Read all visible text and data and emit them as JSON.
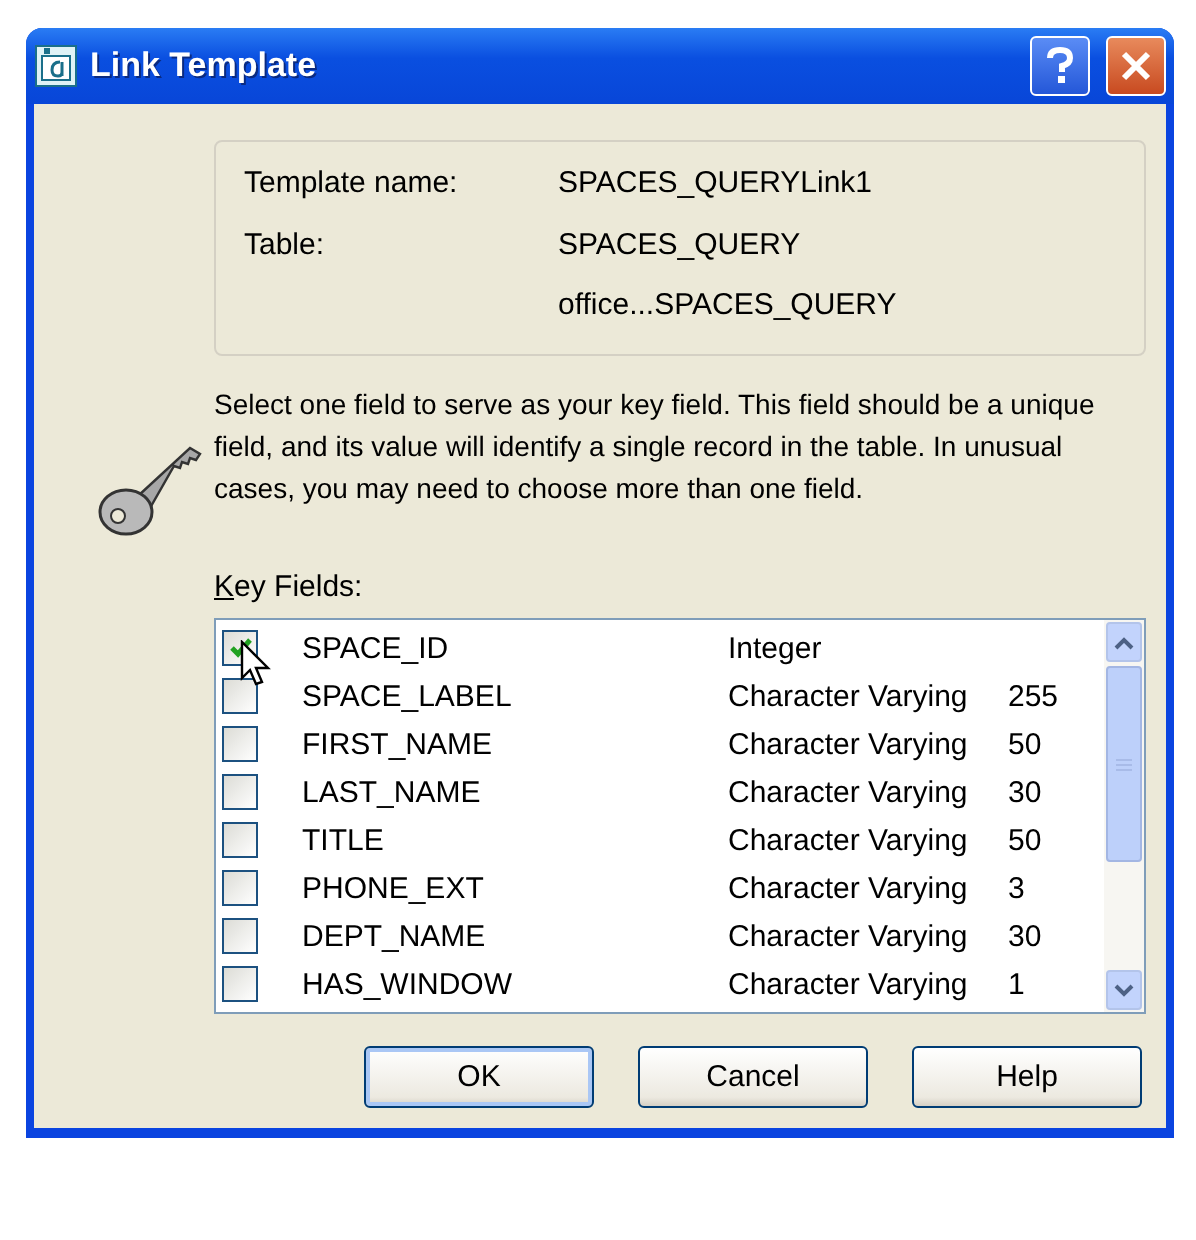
{
  "window": {
    "title": "Link Template"
  },
  "info": [
    {
      "label": "Template name:",
      "value": "SPACES_QUERYLink1"
    },
    {
      "label": "Table:",
      "value": "SPACES_QUERY"
    },
    {
      "value": "office...SPACES_QUERY"
    }
  ],
  "description": "Select one field to serve as your key field. This field should be a unique field, and its value will identify a single record in the table. In unusual cases, you may need to choose more than one field.",
  "key_fields": {
    "label": "Key Fields:",
    "rows": [
      {
        "name": "SPACE_ID",
        "type": "Integer",
        "size": "",
        "checked": true
      },
      {
        "name": "SPACE_LABEL",
        "type": "Character Varying",
        "size": "255",
        "checked": false
      },
      {
        "name": "FIRST_NAME",
        "type": "Character Varying",
        "size": "50",
        "checked": false
      },
      {
        "name": "LAST_NAME",
        "type": "Character Varying",
        "size": "30",
        "checked": false
      },
      {
        "name": "TITLE",
        "type": "Character Varying",
        "size": "50",
        "checked": false
      },
      {
        "name": "PHONE_EXT",
        "type": "Character Varying",
        "size": "3",
        "checked": false
      },
      {
        "name": "DEPT_NAME",
        "type": "Character Varying",
        "size": "30",
        "checked": false
      },
      {
        "name": "HAS_WINDOW",
        "type": "Character Varying",
        "size": "1",
        "checked": false
      }
    ]
  },
  "buttons": [
    "OK",
    "Cancel",
    "Help"
  ]
}
